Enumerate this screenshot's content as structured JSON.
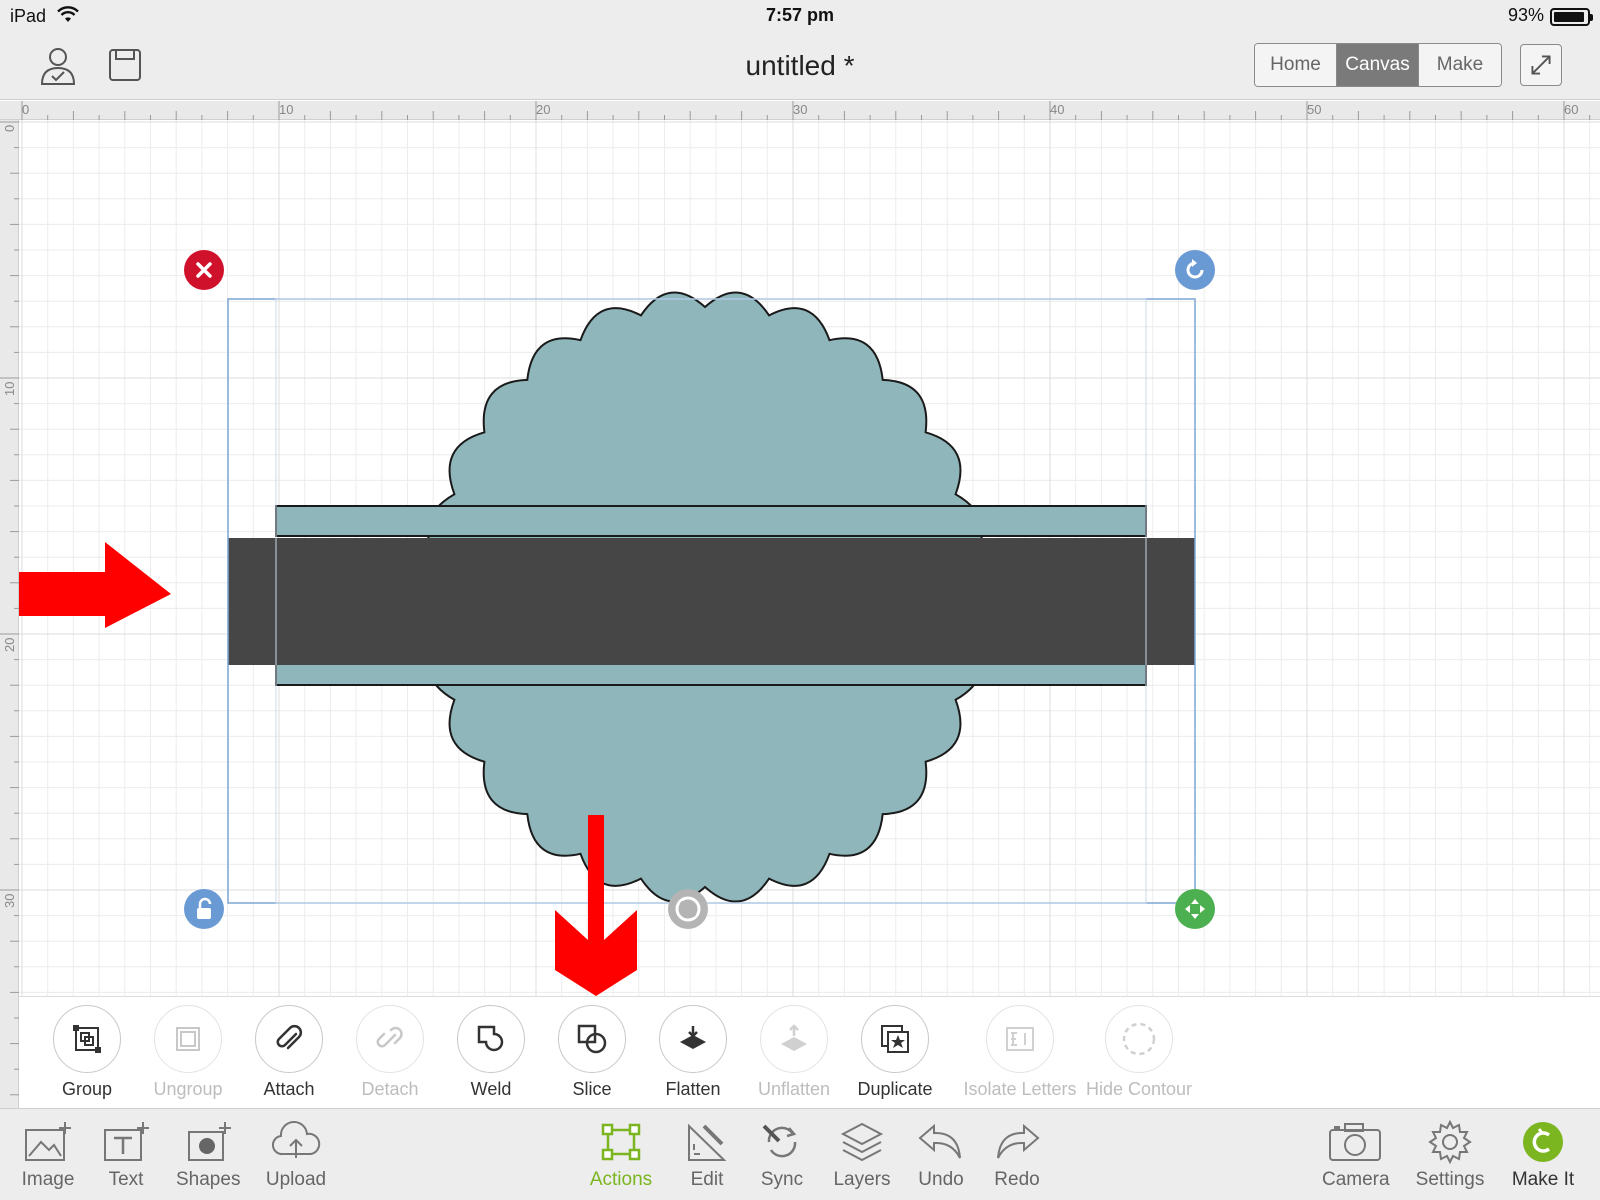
{
  "status_bar": {
    "device": "iPad",
    "time": "7:57 pm",
    "battery": "93%",
    "battery_level": 0.93
  },
  "top_bar": {
    "title": "untitled *",
    "nav": [
      {
        "label": "Home",
        "active": false
      },
      {
        "label": "Canvas",
        "active": true
      },
      {
        "label": "Make",
        "active": false
      }
    ]
  },
  "rulers": {
    "horizontal_labels": [
      "0",
      "10",
      "20",
      "30",
      "40",
      "50",
      "60"
    ],
    "vertical_labels": [
      "0",
      "10",
      "20",
      "30"
    ]
  },
  "actions": [
    {
      "label": "Group",
      "enabled": true,
      "icon": "group-icon"
    },
    {
      "label": "Ungroup",
      "enabled": false,
      "icon": "ungroup-icon"
    },
    {
      "label": "Attach",
      "enabled": true,
      "icon": "paperclip-icon"
    },
    {
      "label": "Detach",
      "enabled": false,
      "icon": "detach-icon"
    },
    {
      "label": "Weld",
      "enabled": true,
      "icon": "weld-icon"
    },
    {
      "label": "Slice",
      "enabled": true,
      "icon": "slice-icon"
    },
    {
      "label": "Flatten",
      "enabled": true,
      "icon": "flatten-icon"
    },
    {
      "label": "Unflatten",
      "enabled": false,
      "icon": "unflatten-icon"
    },
    {
      "label": "Duplicate",
      "enabled": true,
      "icon": "duplicate-icon"
    },
    {
      "label": "Isolate Letters",
      "enabled": false,
      "icon": "isolate-letters-icon"
    },
    {
      "label": "Hide Contour",
      "enabled": false,
      "icon": "hide-contour-icon"
    }
  ],
  "bottom_bar": {
    "left": [
      {
        "label": "Image",
        "icon": "image-add-icon"
      },
      {
        "label": "Text",
        "icon": "text-add-icon"
      },
      {
        "label": "Shapes",
        "icon": "shapes-add-icon"
      },
      {
        "label": "Upload",
        "icon": "upload-cloud-icon"
      }
    ],
    "center": [
      {
        "label": "Actions",
        "icon": "actions-icon",
        "active": true
      },
      {
        "label": "Edit",
        "icon": "edit-icon",
        "active": false
      },
      {
        "label": "Sync",
        "icon": "sync-icon",
        "active": false
      },
      {
        "label": "Layers",
        "icon": "layers-icon",
        "active": false
      },
      {
        "label": "Undo",
        "icon": "undo-icon",
        "active": false
      },
      {
        "label": "Redo",
        "icon": "redo-icon",
        "active": false
      }
    ],
    "right": [
      {
        "label": "Camera",
        "icon": "camera-icon"
      },
      {
        "label": "Settings",
        "icon": "gear-icon"
      },
      {
        "label": "Make It",
        "icon": "make-it-icon"
      }
    ]
  },
  "colors": {
    "shape_fill": "#8fb7bb",
    "band_fill": "#464646",
    "accent_green": "#7bb51f",
    "delete_red": "#d0112b",
    "handle_blue": "#6a9ad3",
    "move_green": "#4caf50",
    "annotation_red": "#ff0000"
  }
}
